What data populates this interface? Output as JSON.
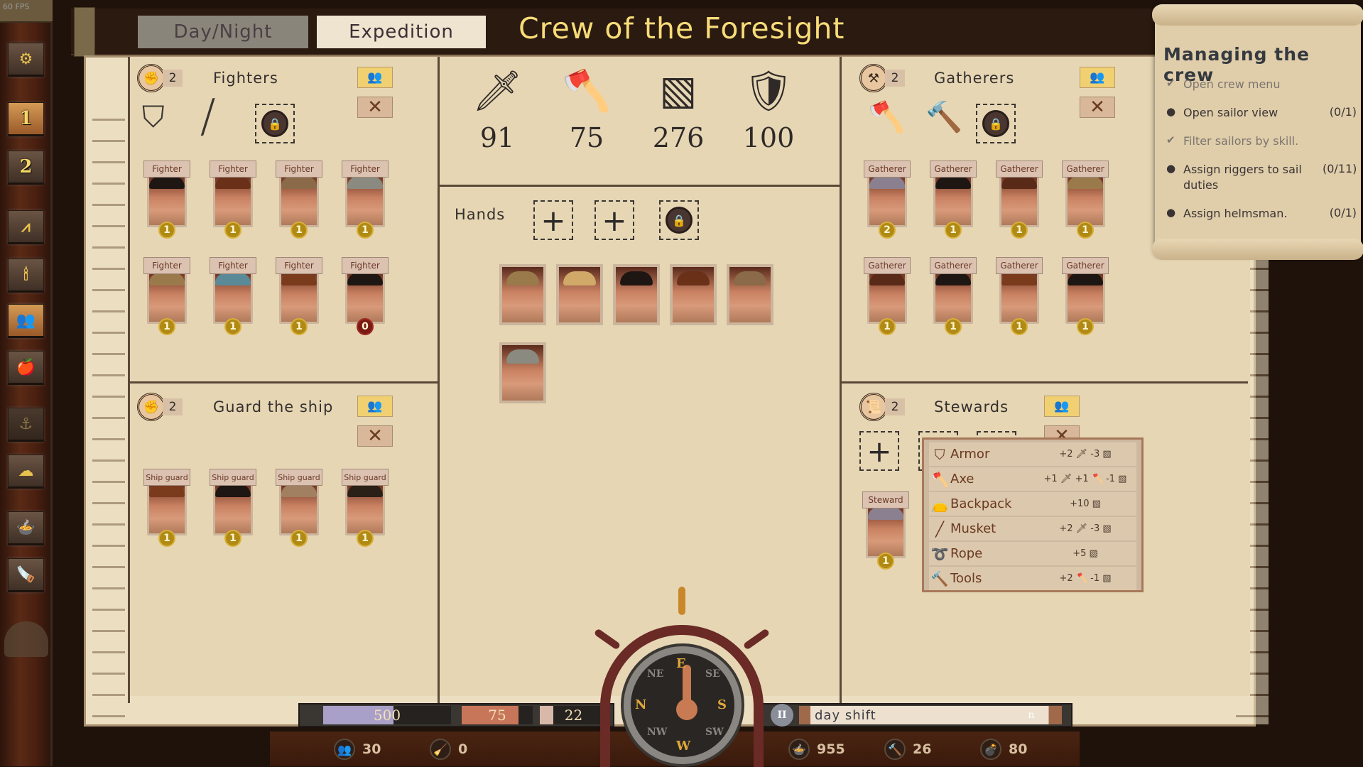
{
  "fps": "60 FPS",
  "sidebar": {
    "items": [
      {
        "name": "settings",
        "icon": "gear-icon",
        "glyph": "⚙",
        "active": false
      },
      {
        "name": "speed-1",
        "label": "1",
        "active": true
      },
      {
        "name": "speed-2",
        "label": "2",
        "active": false
      },
      {
        "name": "navigation",
        "icon": "compass-tool-icon",
        "glyph": "⩘",
        "active": false
      },
      {
        "name": "light",
        "icon": "candle-icon",
        "glyph": "🕯",
        "active": false
      },
      {
        "name": "crew",
        "icon": "crew-icon",
        "glyph": "👥",
        "active": true
      },
      {
        "name": "provisions",
        "icon": "provisions-icon",
        "glyph": "🍎",
        "active": false
      },
      {
        "name": "anchor",
        "icon": "anchor-icon",
        "glyph": "⚓",
        "active": false
      },
      {
        "name": "weather",
        "icon": "weather-icon",
        "glyph": "☁",
        "active": false
      },
      {
        "name": "cooking",
        "icon": "pot-icon",
        "glyph": "🍲",
        "active": false
      },
      {
        "name": "carpentry",
        "icon": "plane-tool-icon",
        "glyph": "🪚",
        "active": false
      }
    ]
  },
  "header": {
    "tabs": [
      {
        "label": "Day/Night",
        "active": false
      },
      {
        "label": "Expedition",
        "active": true
      }
    ],
    "title": "Crew of the Foresight"
  },
  "fighters": {
    "title": "Fighters",
    "skill_level": "2",
    "skill_icon": "fist-icon",
    "equipment": [
      "armor-icon",
      "musket-icon"
    ],
    "crew": [
      {
        "role": "Fighter",
        "level": "1",
        "hair": "#1e1612"
      },
      {
        "role": "Fighter",
        "level": "1",
        "hair": "#6a3018"
      },
      {
        "role": "Fighter",
        "level": "1",
        "hair": "#8a6a48"
      },
      {
        "role": "Fighter",
        "level": "1",
        "hair": "#8a8a80"
      },
      {
        "role": "Fighter",
        "level": "1",
        "hair": "#9a7a4a"
      },
      {
        "role": "Fighter",
        "level": "1",
        "hair": "#5a8a98"
      },
      {
        "role": "Fighter",
        "level": "1",
        "hair": "#7a3a1c"
      },
      {
        "role": "Fighter",
        "level": "0",
        "hair": "#1e1612"
      }
    ]
  },
  "stats": [
    {
      "name": "attack",
      "icon": "sword-icon",
      "glyph": "🗡",
      "value": "91"
    },
    {
      "name": "gathering",
      "icon": "axe-icon",
      "glyph": "🪓",
      "value": "75"
    },
    {
      "name": "capacity",
      "icon": "crate-icon",
      "glyph": "▧",
      "value": "276"
    },
    {
      "name": "defense",
      "icon": "shield-icon",
      "glyph": "🛡",
      "value": "100"
    }
  ],
  "hands": {
    "title": "Hands",
    "crew": [
      {
        "hair": "#9a7a4a"
      },
      {
        "hair": "#d0a868"
      },
      {
        "hair": "#1e1612"
      },
      {
        "hair": "#6a3018"
      },
      {
        "hair": "#8a6a48"
      },
      {
        "hair": "#8a8a80"
      }
    ]
  },
  "gatherers": {
    "title": "Gatherers",
    "skill_level": "2",
    "skill_icon": "crossed-hammers-icon",
    "equipment": [
      "axe-icon",
      "tools-icon"
    ],
    "crew": [
      {
        "role": "Gatherer",
        "level": "2",
        "hair": "#8a8090"
      },
      {
        "role": "Gatherer",
        "level": "1",
        "hair": "#1e1612"
      },
      {
        "role": "Gatherer",
        "level": "1",
        "hair": "#5a2a18"
      },
      {
        "role": "Gatherer",
        "level": "1",
        "hair": "#9a7a4a"
      },
      {
        "role": "Gatherer",
        "level": "1",
        "hair": "#5a2a18"
      },
      {
        "role": "Gatherer",
        "level": "1",
        "hair": "#1e1612"
      },
      {
        "role": "Gatherer",
        "level": "1",
        "hair": "#7a3a1c"
      },
      {
        "role": "Gatherer",
        "level": "1",
        "hair": "#1e1612"
      }
    ]
  },
  "guard": {
    "title": "Guard the ship",
    "skill_level": "2",
    "skill_icon": "fist-icon",
    "crew": [
      {
        "role": "Ship guard",
        "level": "1",
        "hair": "#7a3a1c"
      },
      {
        "role": "Ship guard",
        "level": "1",
        "hair": "#1e1612"
      },
      {
        "role": "Ship guard",
        "level": "1",
        "hair": "#a08060"
      },
      {
        "role": "Ship guard",
        "level": "1",
        "hair": "#2a2018"
      }
    ]
  },
  "stewards": {
    "title": "Stewards",
    "skill_level": "2",
    "skill_icon": "scroll-icon",
    "crew": [
      {
        "role": "Steward",
        "level": "1",
        "hair": "#8a8090"
      }
    ]
  },
  "equipment_menu": [
    {
      "name": "Armor",
      "icon": "armor-icon",
      "glyph": "⛉",
      "effects": "+2 🗡  -3 ▧"
    },
    {
      "name": "Axe",
      "icon": "axe-icon",
      "glyph": "🪓",
      "effects": "+1 🗡  +1 🪓  -1 ▧"
    },
    {
      "name": "Backpack",
      "icon": "backpack-icon",
      "glyph": "👝",
      "effects": "+10 ▧"
    },
    {
      "name": "Musket",
      "icon": "musket-icon",
      "glyph": "╱",
      "effects": "+2 🗡  -3 ▧"
    },
    {
      "name": "Rope",
      "icon": "rope-icon",
      "glyph": "➰",
      "effects": "+5 ▧"
    },
    {
      "name": "Tools",
      "icon": "tools-icon",
      "glyph": "🔨",
      "effects": "+2 🪓  -1 ▧"
    }
  ],
  "quest": {
    "title": "Managing the crew",
    "items": [
      {
        "text": "Open crew menu",
        "count": "",
        "done": true
      },
      {
        "text": "Open sailor view",
        "count": "(0/1)",
        "done": false
      },
      {
        "text": "Filter sailors by skill.",
        "count": "",
        "done": true
      },
      {
        "text": "Assign riggers to sail duties",
        "count": "(0/11)",
        "done": false
      },
      {
        "text": "Assign helmsman.",
        "count": "(0/1)",
        "done": false
      }
    ]
  },
  "bottom": {
    "meters": [
      {
        "name": "hull",
        "value": "500",
        "color": "#a8a0c8",
        "fill": 0.55
      },
      {
        "name": "health",
        "value": "75",
        "color": "#c8765a",
        "fill": 0.8
      },
      {
        "name": "morale",
        "value": "22",
        "color": "#d8b8a8",
        "fill": 0.2
      }
    ],
    "shift_label": "day shift",
    "shift_end_glyph": "n",
    "pause_glyph": "II",
    "resources_left": [
      {
        "name": "crew-count",
        "icon": "crew-icon",
        "glyph": "👥",
        "value": "30"
      },
      {
        "name": "cleaning",
        "icon": "broom-icon",
        "glyph": "🧹",
        "value": "0"
      }
    ],
    "resources_right": [
      {
        "name": "food",
        "icon": "food-bowl-icon",
        "glyph": "🍲",
        "value": "955"
      },
      {
        "name": "tools",
        "icon": "hammer-icon",
        "glyph": "🔨",
        "value": "26"
      },
      {
        "name": "ammo",
        "icon": "bomb-icon",
        "glyph": "💣",
        "value": "80"
      }
    ],
    "compass": {
      "heading": "E",
      "directions": [
        "E",
        "SE",
        "S",
        "SW",
        "W",
        "NW",
        "N",
        "NE"
      ]
    }
  }
}
